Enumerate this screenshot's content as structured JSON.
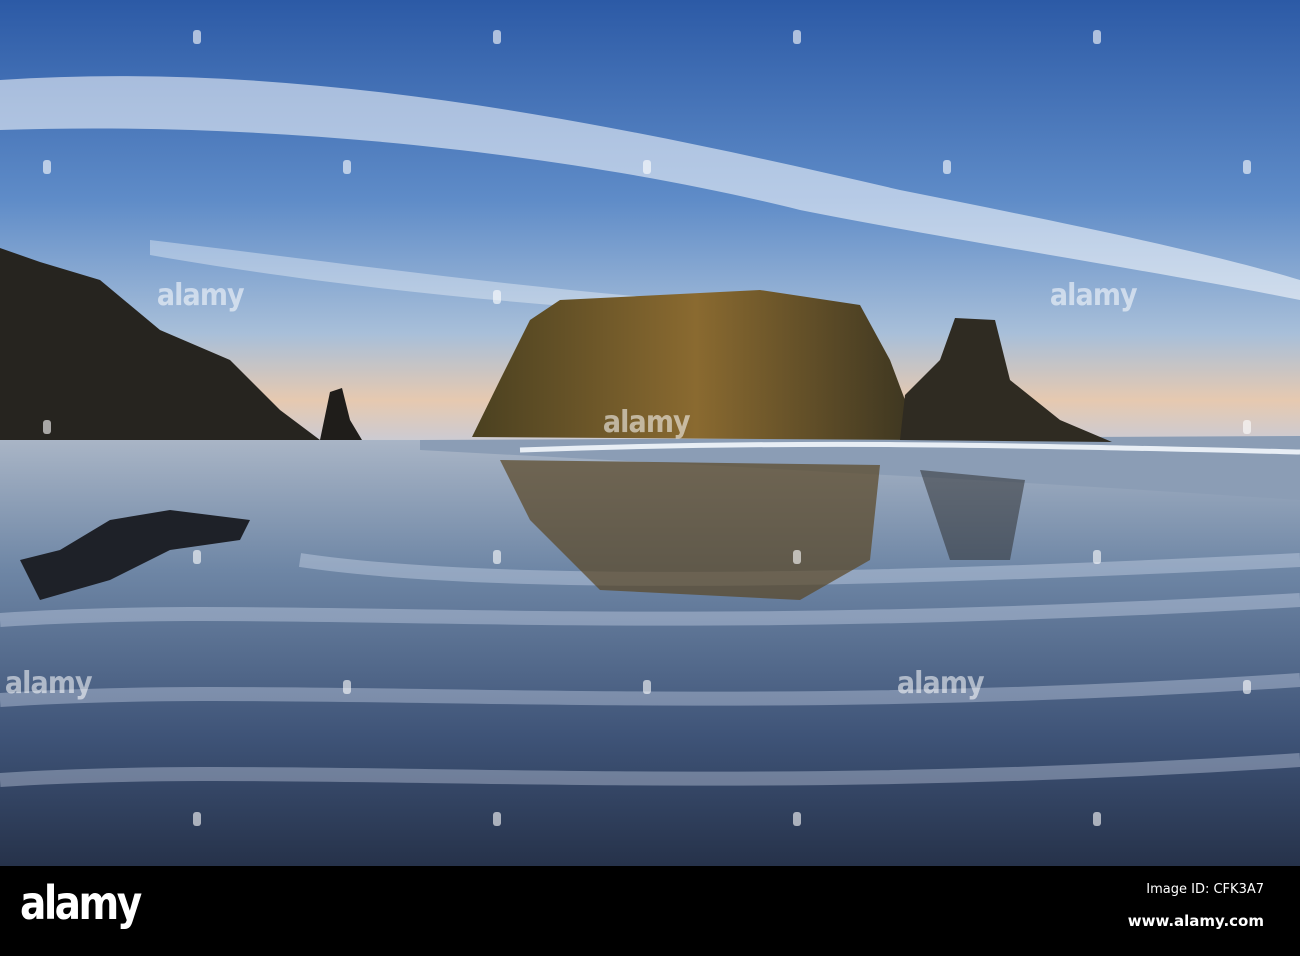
{
  "watermark": {
    "text": "alamy"
  },
  "footer": {
    "logo": "alamy",
    "image_id": "Image ID: CFK3A7",
    "website": "www.alamy.com"
  }
}
